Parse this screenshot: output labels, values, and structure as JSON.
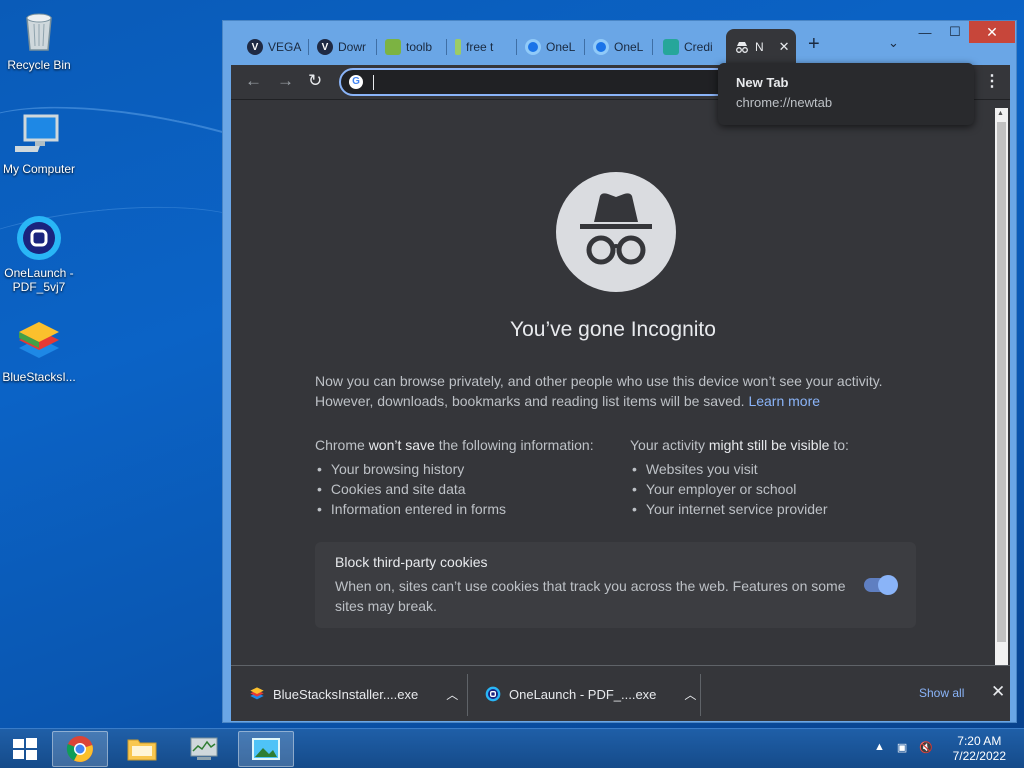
{
  "desktop": {
    "icons": [
      {
        "label": "Recycle Bin",
        "icon": "recycle-bin-icon"
      },
      {
        "label": "My Computer",
        "icon": "computer-icon"
      },
      {
        "label": "OneLaunch -\nPDF_5vj7",
        "icon": "onelaunch-icon"
      },
      {
        "label": "BlueStacksI...",
        "icon": "bluestacks-icon"
      }
    ]
  },
  "browser": {
    "tabs": [
      {
        "label": "VEGA",
        "favicon": "V",
        "color": "#1f2a44"
      },
      {
        "label": "Dowr",
        "favicon": "V",
        "color": "#1f2a44"
      },
      {
        "label": "toolb",
        "favicon": "",
        "color": "#7cb342"
      },
      {
        "label": "free t",
        "favicon": "",
        "color": "#9ccc65"
      },
      {
        "label": "OneL",
        "favicon": "",
        "color": "#1a73e8"
      },
      {
        "label": "OneL",
        "favicon": "",
        "color": "#1a73e8"
      },
      {
        "label": "Credi",
        "favicon": "",
        "color": "#26a69a"
      },
      {
        "label": "N",
        "favicon": "",
        "color": "#35363a"
      }
    ],
    "window_buttons": {
      "minimize": "—",
      "maximize": "☐",
      "close": "✕"
    },
    "new_tab_plus": "+",
    "tab_dropdown": "⌄",
    "omnibox": {
      "value": "",
      "placeholder": ""
    },
    "tooltip": {
      "title": "New Tab",
      "url": "chrome://newtab"
    },
    "incognito": {
      "heading": "You’ve gone Incognito",
      "para1": "Now you can browse privately, and other people who use this device won’t see your activity. However, downloads, bookmarks and reading list items will be saved.",
      "learn_more": "Learn more",
      "left_head_pre": "Chrome ",
      "left_head_bold": "won’t save",
      "left_head_post": " the following information:",
      "left_items": [
        "Your browsing history",
        "Cookies and site data",
        "Information entered in forms"
      ],
      "right_head_pre": "Your activity ",
      "right_head_bold": "might still be visible",
      "right_head_post": " to:",
      "right_items": [
        "Websites you visit",
        "Your employer or school",
        "Your internet service provider"
      ],
      "cookie_title": "Block third-party cookies",
      "cookie_desc": "When on, sites can’t use cookies that track you across the web. Features on some sites may break.",
      "cookie_toggle_on": true
    },
    "downloads": {
      "items": [
        {
          "name": "BlueStacksInstaller....exe",
          "icon": "bluestacks-icon"
        },
        {
          "name": "OneLaunch - PDF_....exe",
          "icon": "onelaunch-icon"
        }
      ],
      "show_all": "Show all",
      "close": "✕"
    }
  },
  "taskbar": {
    "time": "7:20 AM",
    "date": "7/22/2022",
    "items": [
      "start-button",
      "chrome",
      "file-explorer",
      "task-manager",
      "image-viewer"
    ]
  }
}
